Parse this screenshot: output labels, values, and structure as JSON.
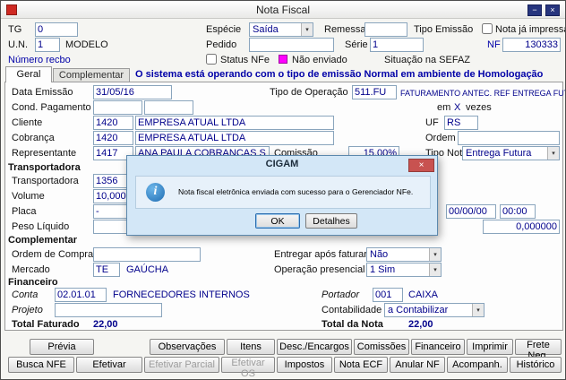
{
  "colors": {
    "navy_value": "#00008B",
    "blue_label": "#0000A8",
    "nfe_magenta": "#FF00FF",
    "dialog_blue": "#D3E7F7",
    "close_red": "#C85250"
  },
  "icons": {
    "minimize": "−",
    "close": "×",
    "combo_arrow": "▾",
    "info_glyph": "i",
    "dialog_close": "×"
  },
  "window": {
    "title": "Nota Fiscal"
  },
  "top": {
    "tg_label": "TG",
    "tg_value": "0",
    "especie_label": "Espécie",
    "especie_value": "Saída",
    "remessa_label": "Remessa",
    "remessa_value": "",
    "tipo_emissao_label": "Tipo Emissão",
    "nota_ja_impressa_label": "Nota já impressa",
    "un_label": "U.N.",
    "un_value": "1",
    "un_desc": "MODELO",
    "pedido_label": "Pedido",
    "pedido_value": "",
    "serie_label": "Série",
    "serie_value": "1",
    "nf_label": "NF",
    "nf_value": "130333",
    "numero_recbo_label": "Número recbo",
    "status_nfe_label": "Status NFe",
    "nao_enviado_label": "Não enviado",
    "situacao_sefaz_label": "Situação na SEFAZ"
  },
  "tabs": {
    "geral": "Geral",
    "complementar": "Complementar",
    "status_message": "O sistema está operando com o tipo de emissão Normal em ambiente de Homologação"
  },
  "geral": {
    "data_emissao_label": "Data Emissão",
    "data_emissao_value": "31/05/16",
    "tipo_operacao_label": "Tipo de Operação",
    "tipo_operacao_code": "511.FU",
    "tipo_operacao_desc": "FATURAMENTO ANTEC. REF ENTREGA FUTURA",
    "cond_pagamento_label": "Cond. Pagamento",
    "cond_pagamento_value1": "",
    "cond_pagamento_value2": "",
    "em_label": "em",
    "vezes_x": "X",
    "vezes_label": "vezes",
    "cliente_label": "Cliente",
    "cliente_code": "1420",
    "cliente_name": "EMPRESA ATUAL LTDA",
    "uf_label": "UF",
    "uf_value": "RS",
    "cobranca_label": "Cobrança",
    "cobranca_code": "1420",
    "cobranca_name": "EMPRESA ATUAL LTDA",
    "ordem_label": "Ordem",
    "ordem_value": "",
    "representante_label": "Representante",
    "representante_code": "1417",
    "representante_name": "ANA PAULA COBRANÇAS S.A.",
    "comissao_label": "Comissão",
    "comissao_value": "15,00%",
    "tipo_nota_label": "Tipo Nota",
    "tipo_nota_value": "Entrega Futura"
  },
  "transportadora": {
    "section_label": "Transportadora",
    "transportadora_label": "Transportadora",
    "transportadora_code": "1356",
    "transportadora_name": "",
    "volume_label": "Volume",
    "volume_value": "10,000",
    "placa_label": "Placa",
    "placa_value": "-",
    "data_value": "00/00/00",
    "hora_value": "00:00",
    "peso_liquido_label": "Peso Líquido",
    "peso_liquido_value": "",
    "peso_right_value": "0,000000"
  },
  "complementar": {
    "section_label": "Complementar",
    "ordem_compra_label": "Ordem de Compra",
    "ordem_compra_value": "",
    "entregar_apos_label": "Entregar após faturar",
    "entregar_apos_value": "Não",
    "mercado_label": "Mercado",
    "mercado_code": "TE",
    "mercado_name": "GAÚCHA",
    "operacao_presencial_label": "Operação presencial",
    "operacao_presencial_value": "1 Sim"
  },
  "financeiro": {
    "section_label": "Financeiro",
    "conta_label": "Conta",
    "conta_code": "02.01.01",
    "conta_name": "FORNECEDORES INTERNOS",
    "portador_label": "Portador",
    "portador_code": "001",
    "portador_name": "CAIXA",
    "projeto_label": "Projeto",
    "projeto_value": "",
    "contabilidade_label": "Contabilidade",
    "contabilidade_value": "a Contabilizar",
    "total_faturado_label": "Total Faturado",
    "total_faturado_value": "22,00",
    "total_nota_label": "Total da Nota",
    "total_nota_value": "22,00"
  },
  "dialog": {
    "title": "CIGAM",
    "message": "Nota fiscal eletrônica enviada com sucesso para o Gerenciador NFe.",
    "ok_label": "OK",
    "detalhes_label": "Detalhes"
  },
  "buttons_row1": [
    "Prévia",
    "Observações",
    "Itens",
    "Desc./Encargos",
    "Comissões",
    "Financeiro",
    "Imprimir",
    "Frete Neg."
  ],
  "buttons_row2": [
    "Busca NFE",
    "Efetivar",
    "Efetivar Parcial",
    "Efetivar OS",
    "Impostos",
    "Nota ECF",
    "Anular NF",
    "Acompanh.",
    "Histórico"
  ]
}
